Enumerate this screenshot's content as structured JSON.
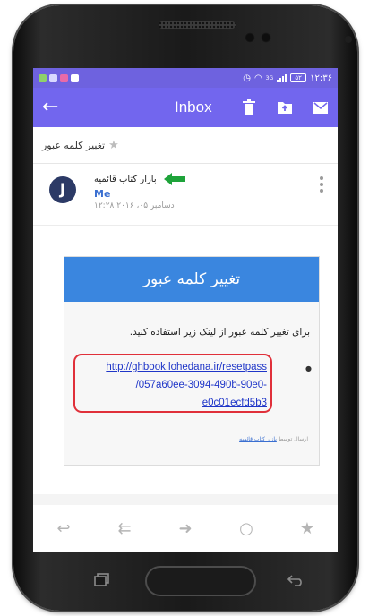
{
  "status_bar": {
    "time": "۱۲:۳۶",
    "battery": "۵۲",
    "network_label": "3G"
  },
  "app_bar": {
    "title": "Inbox",
    "back_icon": "arrow-left-icon",
    "actions": [
      "archive-icon",
      "move-to-folder-icon",
      "mail-icon"
    ],
    "color": "#7266ee"
  },
  "subject": "تغییر کلمه عبور",
  "message": {
    "sender": "بازار کتاب قائمیه",
    "avatar_letter": "J",
    "recipient": "Me",
    "date": "دسامبر ۰۵، ۲۰۱۶ ۱۲:۲۸"
  },
  "card": {
    "header": "تغییر کلمه عبور",
    "instruction": "برای تغییر کلمه عبور از لینک زیر استفاده کنید.",
    "link_lines": [
      "http://ghbook.lohedana.ir/resetpass",
      "/057a60ee-3094-490b-90e0-",
      "e0c01ecfd5b3"
    ],
    "footer_prefix": "ارسال توسط",
    "footer_link": "بازار کتاب قائمیه",
    "header_color": "#3a86df",
    "highlight_color": "#e0303a"
  },
  "bottom_actions": [
    "reply-icon",
    "reply-all-icon",
    "forward-icon",
    "circle-icon",
    "star-icon"
  ]
}
